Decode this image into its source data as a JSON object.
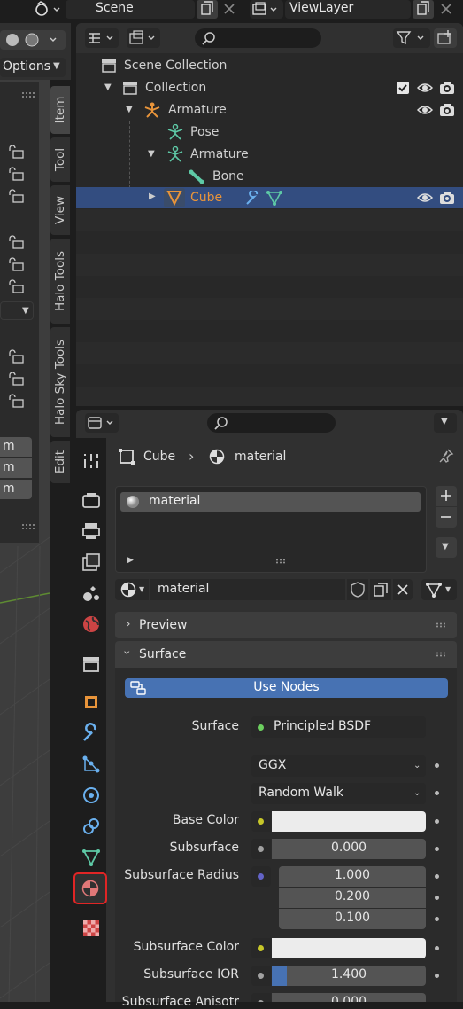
{
  "topbar": {
    "scene_name": "Scene",
    "viewlayer_name": "ViewLayer"
  },
  "left_panel": {
    "options_label": "Options",
    "tabs": [
      "Item",
      "Tool",
      "View",
      "Halo Tools",
      "Halo Sky Tools",
      "Edit"
    ],
    "fields": [
      "m",
      "m",
      "m"
    ]
  },
  "outliner": {
    "search_placeholder": "",
    "items": [
      {
        "label": "Scene Collection"
      },
      {
        "label": "Collection"
      },
      {
        "label": "Armature"
      },
      {
        "label": "Pose"
      },
      {
        "label": "Armature"
      },
      {
        "label": "Bone"
      },
      {
        "label": "Cube"
      }
    ]
  },
  "properties": {
    "breadcrumb_object": "Cube",
    "breadcrumb_material": "material",
    "slot_name": "material",
    "material_name": "material",
    "panels": {
      "preview": "Preview",
      "surface": "Surface"
    },
    "use_nodes_label": "Use Nodes",
    "surface_label": "Surface",
    "surface_shader": "Principled BSDF",
    "distribution": "GGX",
    "subsurface_method": "Random Walk",
    "rows": {
      "base_color_label": "Base Color",
      "subsurface_label": "Subsurface",
      "subsurface_value": "0.000",
      "subsurface_radius_label": "Subsurface Radius",
      "radius_x": "1.000",
      "radius_y": "0.200",
      "radius_z": "0.100",
      "subsurface_color_label": "Subsurface Color",
      "subsurface_ior_label": "Subsurface IOR",
      "subsurface_ior_value": "1.400",
      "subsurface_ior_fill": 0.1,
      "subsurface_anisotropy_label": "Subsurface Anisotr",
      "subsurface_anisotropy_value": "0.000"
    }
  },
  "colors": {
    "selected_row": "#334d80",
    "use_nodes_button": "#4772b3",
    "accent_orange": "#e8943a",
    "shader_dot": "#6ccf5f",
    "color_socket": "#c7c729",
    "float_socket": "#a1a1a1",
    "vector_socket": "#6363c7",
    "active_tab_outline": "#e02525"
  }
}
